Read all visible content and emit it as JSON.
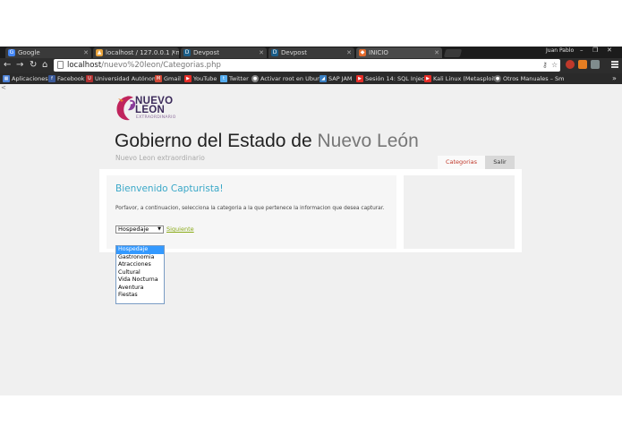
{
  "browser": {
    "tabs": [
      {
        "title": "Google",
        "favicon": "google-icon",
        "color": "#4285f4",
        "active": false
      },
      {
        "title": "localhost / 127.0.0.1 / nue",
        "favicon": "phpmyadmin-icon",
        "color": "#e8a33c",
        "active": false
      },
      {
        "title": "Devpost",
        "favicon": "devpost-icon",
        "color": "#1b5e89",
        "active": false
      },
      {
        "title": "Devpost",
        "favicon": "devpost-icon",
        "color": "#1b5e89",
        "active": false
      },
      {
        "title": "INICIO",
        "favicon": "site-icon",
        "color": "#e36a2c",
        "active": true
      }
    ],
    "user_name": "Juan Pablo",
    "url_host": "localhost",
    "url_path": "/nuevo%20leon/Categorias.php",
    "bookmarks": [
      {
        "label": "Aplicaciones",
        "icon": "apps-icon",
        "color": "#4a7fd4"
      },
      {
        "label": "Facebook",
        "icon": "facebook-icon",
        "color": "#3b5998"
      },
      {
        "label": "Universidad Autónom",
        "icon": "university-icon",
        "color": "#b03030"
      },
      {
        "label": "Gmail",
        "icon": "gmail-icon",
        "color": "#d14836"
      },
      {
        "label": "YouTube",
        "icon": "youtube-icon",
        "color": "#e52d27"
      },
      {
        "label": "Twitter",
        "icon": "twitter-icon",
        "color": "#55acee"
      },
      {
        "label": "Activar root en Ubun",
        "icon": "globe-icon",
        "color": "#8a8a8a"
      },
      {
        "label": "SAP JAM",
        "icon": "sap-icon",
        "color": "#3a7fc1"
      },
      {
        "label": "Sesión 14: SQL Injecti",
        "icon": "youtube-icon",
        "color": "#e52d27"
      },
      {
        "label": "Kali Linux (Metasploit",
        "icon": "youtube-icon",
        "color": "#e52d27"
      },
      {
        "label": "Otros Manuales – Sm",
        "icon": "globe-icon",
        "color": "#6a6a6a"
      }
    ]
  },
  "site": {
    "logo_line1": "NUEVO",
    "logo_line2": "LEON",
    "logo_tagline": "EXTRAORDINARIO",
    "title_main": "Gobierno del Estado de",
    "title_light": "Nuevo León",
    "subtitle": "Nuevo Leon extraordinario",
    "nav": {
      "categorias": "Categorias",
      "salir": "Salir"
    }
  },
  "form": {
    "welcome": "Bienvenido Capturista!",
    "instructions": "Porfavor, a continuacion, selecciona la categoria a la que pertenece la informacion que desea capturar.",
    "selected": "Hospedaje",
    "next_link": "Siguiente",
    "options": [
      "Hospedaje",
      "Gastronomia",
      "Atracciones",
      "Cultural",
      "Vida Nocturna",
      "Aventura",
      "Fiestas"
    ]
  }
}
